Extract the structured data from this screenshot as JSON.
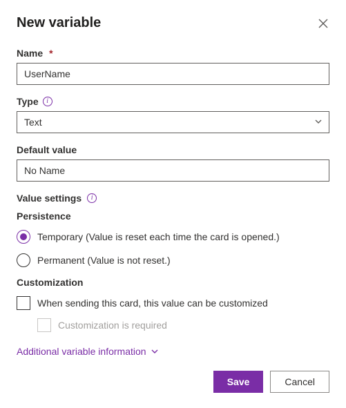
{
  "dialog": {
    "title": "New variable"
  },
  "fields": {
    "name": {
      "label": "Name",
      "value": "UserName",
      "required": "*"
    },
    "type": {
      "label": "Type",
      "value": "Text"
    },
    "default": {
      "label": "Default value",
      "value": "No Name"
    }
  },
  "valueSettings": {
    "label": "Value settings",
    "persistence": {
      "label": "Persistence",
      "temporary": "Temporary (Value is reset each time the card is opened.)",
      "permanent": "Permanent (Value is not reset.)"
    },
    "customization": {
      "label": "Customization",
      "sendCustom": "When sending this card, this value can be customized",
      "required": "Customization is required"
    }
  },
  "additional": {
    "label": "Additional variable information"
  },
  "buttons": {
    "save": "Save",
    "cancel": "Cancel"
  }
}
